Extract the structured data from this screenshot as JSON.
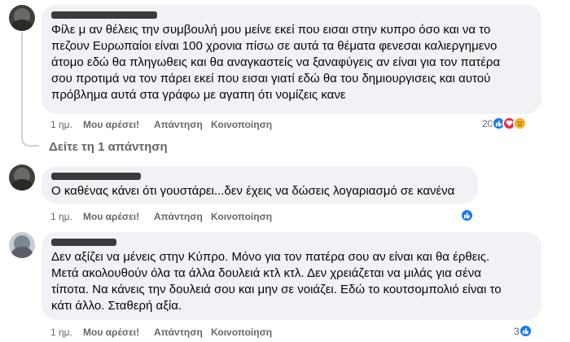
{
  "comments": [
    {
      "text_lines": [
        "Φίλε μ αν θέλεις την συμβουλή μου μείνε εκεί που εισαι στην κυπρο όσο και να το",
        "πεζουν Ευρωπαίοι είναι 100 χρονια πίσω σε αυτά τα θέματα φενεσαι καλιεργημενο",
        "άτομο εδώ θα πληγωθεις και θα αναγκαστείς να ξαναφύγεις αν είναι για τον πατέρα",
        "σου προτιμά να τον πάρει εκεί που εισαι γιατί εδώ θα του δημιουργισεις και αυτού",
        "πρόβλημα αυτά στα γράφω με αγαπη ότι νομίζεις κανε"
      ],
      "time": "1 ημ.",
      "like_label": "Μου αρέσει!",
      "reply_label": "Απάντηση",
      "share_label": "Κοινοποίηση",
      "reaction_count": "20",
      "reactions": [
        "like-icon",
        "love-icon",
        "sad-icon"
      ],
      "see_replies": "Δείτε τη 1 απάντηση"
    },
    {
      "text_lines": [
        "Ο καθένας κάνει ότι γουστάρει...δεν έχεις να δώσεις λογαριασμό σε κανένα"
      ],
      "time": "1 ημ.",
      "like_label": "Μου αρέσει!",
      "reply_label": "Απάντηση",
      "share_label": "Κοινοποίηση",
      "reaction_count": "",
      "reactions": [
        "like-icon"
      ]
    },
    {
      "text_lines": [
        "Δεν αξίζει να μένεις στην Κύπρο. Μόνο για τον πατέρα σου αν είναι και θα έρθεις.",
        "Μετά ακολουθούν όλα τα άλλα δουλειά κτλ κτλ. Δεν χρειάζεται να μιλάς για σένα",
        "τίποτα. Να κάνεις την δουλειά σου και μην σε νοιάζει. Εδώ το κουτσομπολιό είναι το",
        "κάτι άλλο. Σταθερή αξία."
      ],
      "time": "1 ημ.",
      "like_label": "Μου αρέσει!",
      "reply_label": "Απάντηση",
      "share_label": "Κοινοποίηση",
      "reaction_count": "3",
      "reactions": [
        "like-icon"
      ]
    }
  ]
}
